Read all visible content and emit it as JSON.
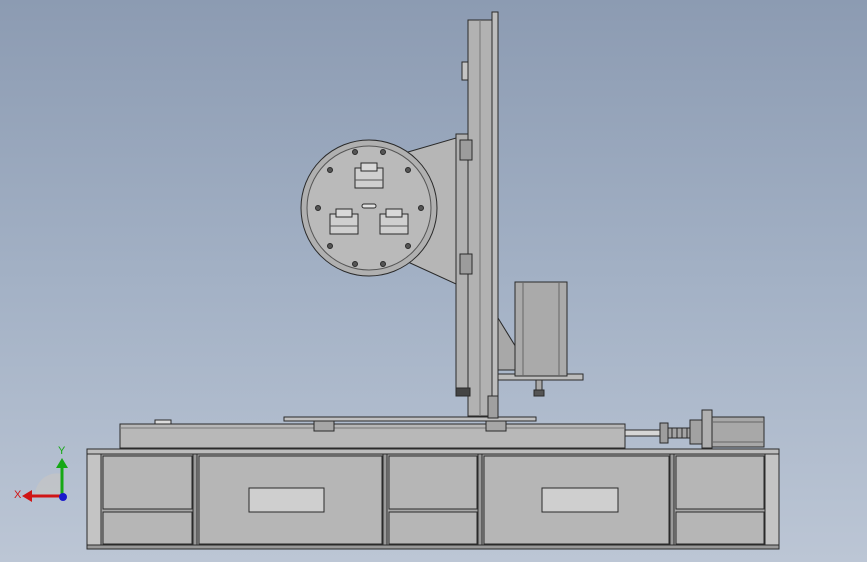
{
  "colors": {
    "background_top": "#8c9bb2",
    "background_bottom": "#bcc6d5",
    "part_fill": "#b4b4b4",
    "part_light": "#c8c8c8",
    "part_dark": "#8a8a8a",
    "edge": "#2a2a2a",
    "axis_x": "#d01515",
    "axis_y": "#16a816",
    "axis_z": "#1a1acc"
  },
  "triad": {
    "x_label": "X",
    "y_label": "Y"
  }
}
